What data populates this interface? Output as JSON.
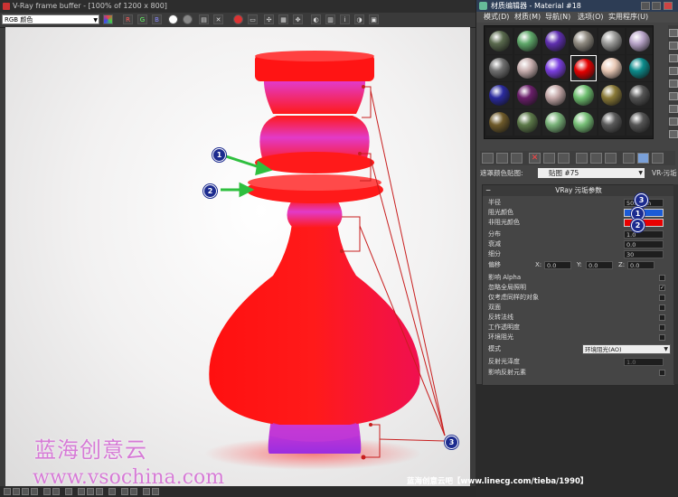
{
  "vfb": {
    "title": "V-Ray frame buffer - [100% of 1200 x 800]",
    "channel": "RGB 颜色",
    "channel_buttons": [
      "R",
      "G",
      "B"
    ]
  },
  "watermark": {
    "line1": "蓝海创意云",
    "line2": "www.vsochina.com",
    "credit": "蓝海创意云吧【www.linecg.com/tieba/1990】"
  },
  "material_editor": {
    "title": "材质编辑器 - Material #18",
    "menu": [
      "模式(D)",
      "材质(M)",
      "导航(N)",
      "选项(O)",
      "实用程序(U)"
    ],
    "slot_colors": [
      "#5a6a4e",
      "#5fa86a",
      "#5f2fb0",
      "#8f8a80",
      "#9a9a98",
      "#b8a4c8",
      "#707070",
      "#c9b0b0",
      "#7b3fe0",
      "#f2c0b8",
      "#e9c9b6",
      "#0c8c8c",
      "#2a2a9e",
      "#6a1f6a",
      "#c4a8a8",
      "#6fbf70",
      "#8a7a38",
      "#555555",
      "#6e5a2a",
      "#5d7a4a",
      "#79b279",
      "#77bf77",
      "#5a5a5a",
      "#555555"
    ],
    "selected_slot_color": "#e30000",
    "picker_label": "遮罩颜色贴图:",
    "material_name": "贴图 #75",
    "material_type": "VR-污垢",
    "rollout_title": "VRay 污垢参数",
    "params": [
      {
        "label": "半径",
        "value": "50.0mm"
      },
      {
        "label": "阻光颜色",
        "value": ""
      },
      {
        "label": "非阻光颜色",
        "value": ""
      },
      {
        "label": "分布",
        "value": "1.0"
      },
      {
        "label": "衰减",
        "value": "0.0"
      },
      {
        "label": "细分",
        "value": "30"
      },
      {
        "label": "偏移",
        "value": ""
      },
      {
        "label": "影响 Alpha",
        "value": ""
      },
      {
        "label": "忽略全局照明",
        "value": ""
      },
      {
        "label": "仅考虑同样的对象",
        "value": ""
      },
      {
        "label": "双面",
        "value": ""
      },
      {
        "label": "反转法线",
        "value": ""
      },
      {
        "label": "工作透明度",
        "value": ""
      },
      {
        "label": "环境阻光",
        "value": ""
      },
      {
        "label": "模式",
        "value": "环境阻光(AO)"
      },
      {
        "label": "反射光泽度",
        "value": "1.0"
      },
      {
        "label": "影响反射元素",
        "value": ""
      }
    ],
    "offset": {
      "x_label": "X:",
      "x": "0.0",
      "y_label": "Y:",
      "y": "0.0",
      "z_label": "Z:",
      "z": "0.0"
    },
    "occluded_color": "#1b5bd6",
    "unoccluded_color": "#e80000"
  },
  "callouts": [
    "1",
    "2",
    "3"
  ],
  "colors": {
    "vase_red": "#ff1a1a",
    "vase_purple": "#c03ad8",
    "callout_blue": "#1c2b8f",
    "arrow_green": "#2fbf3f",
    "leader_red": "#c81e1e"
  }
}
